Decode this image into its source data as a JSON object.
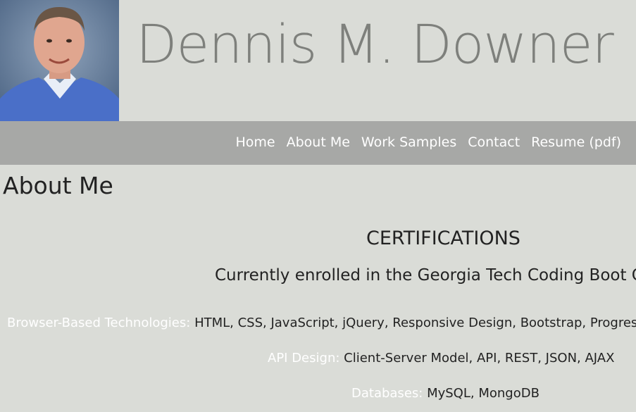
{
  "header": {
    "name": "Dennis M. Downer",
    "photo_alt": "Portrait of Dennis M. Downer"
  },
  "nav": {
    "items": [
      {
        "label": "Home"
      },
      {
        "label": "About Me"
      },
      {
        "label": "Work Samples"
      },
      {
        "label": "Contact"
      },
      {
        "label": "Resume (pdf)"
      }
    ]
  },
  "main": {
    "heading": "About Me",
    "certifications_title": "CERTIFICATIONS",
    "enrolled_text": "Currently enrolled in the Georgia Tech Coding Boot Ca",
    "skills": [
      {
        "label": "Browser-Based Technologies:",
        "value": "HTML, CSS, JavaScript, jQuery, Responsive Design, Bootstrap, Progress"
      },
      {
        "label": "API Design:",
        "value": "Client-Server Model, API, REST, JSON, AJAX"
      },
      {
        "label": "Databases:",
        "value": "MySQL, MongoDB"
      }
    ]
  },
  "colors": {
    "page_background": "#dadcd7",
    "nav_background": "#a7a8a6",
    "title_gray": "#7e807c",
    "label_white": "#ffffff"
  }
}
